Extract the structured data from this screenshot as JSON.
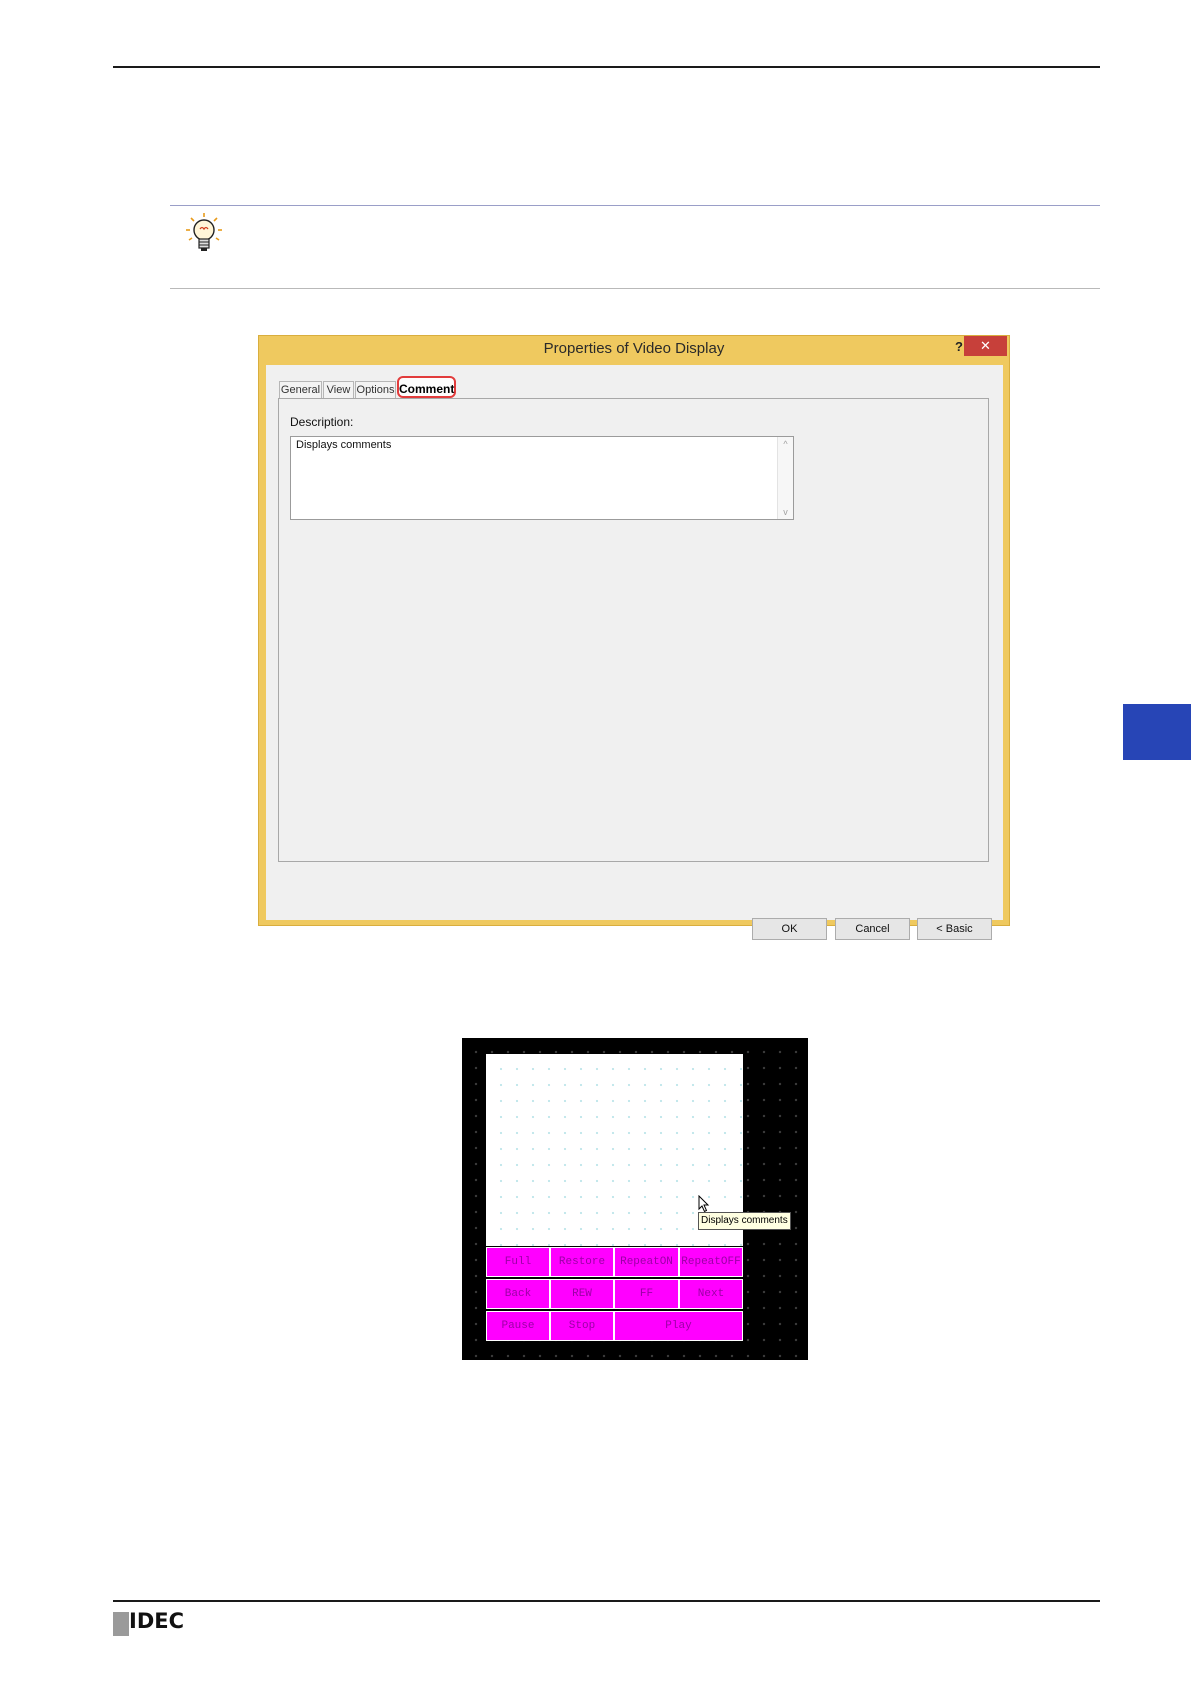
{
  "dialog": {
    "title": "Properties of Video Display",
    "help_glyph": "?",
    "close_glyph": "✕",
    "tabs": [
      {
        "label": "General"
      },
      {
        "label": "View"
      },
      {
        "label": "Options"
      },
      {
        "label": "Comment",
        "active": true
      }
    ],
    "description_label": "Description:",
    "description_value": "Displays comments",
    "scroll_up": "^",
    "scroll_down": "v",
    "buttons": {
      "ok": "OK",
      "cancel": "Cancel",
      "basic": "< Basic"
    }
  },
  "preview": {
    "buttons": [
      [
        "Full",
        "Restore",
        "RepeatON",
        "RepeatOFF"
      ],
      [
        "Back",
        "REW",
        "FF",
        "Next"
      ],
      [
        "Pause",
        "Stop",
        "Play"
      ]
    ],
    "tooltip": "Displays comments",
    "button_color": "#ff00ff"
  },
  "footer": {
    "logo": "IDEC"
  },
  "colors": {
    "dialog_frame": "#efc95f",
    "close_button": "#c7403a",
    "side_tab": "#2745b6",
    "highlight": "#e23c3c"
  }
}
